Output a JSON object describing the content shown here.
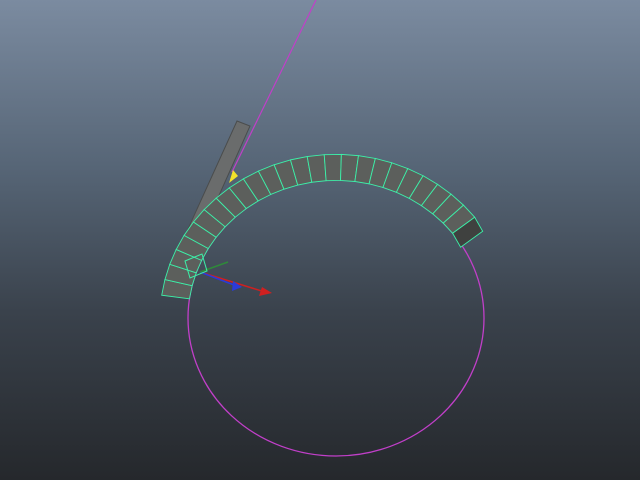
{
  "viewport": {
    "background_top": "#7b8ba0",
    "background_bottom": "#25282c"
  },
  "scene": {
    "curve_color": "#c13fc9",
    "selection_wire_color": "#3cf0a8",
    "mesh_face_color": "#5c5f5c",
    "mesh_edge_color": "#2c2e2c",
    "pivot_highlight_color": "#f2e22a",
    "bar_color": "#6a6c6c",
    "segment_count": 24
  },
  "manipulator": {
    "x_axis_color": "#d02020",
    "y_axis_color": "#2b3bd8",
    "z_axis_color": "#2f8a3a",
    "icons": [
      "translate-x-arrow-icon",
      "translate-y-arrow-icon",
      "translate-z-arrow-icon"
    ]
  }
}
